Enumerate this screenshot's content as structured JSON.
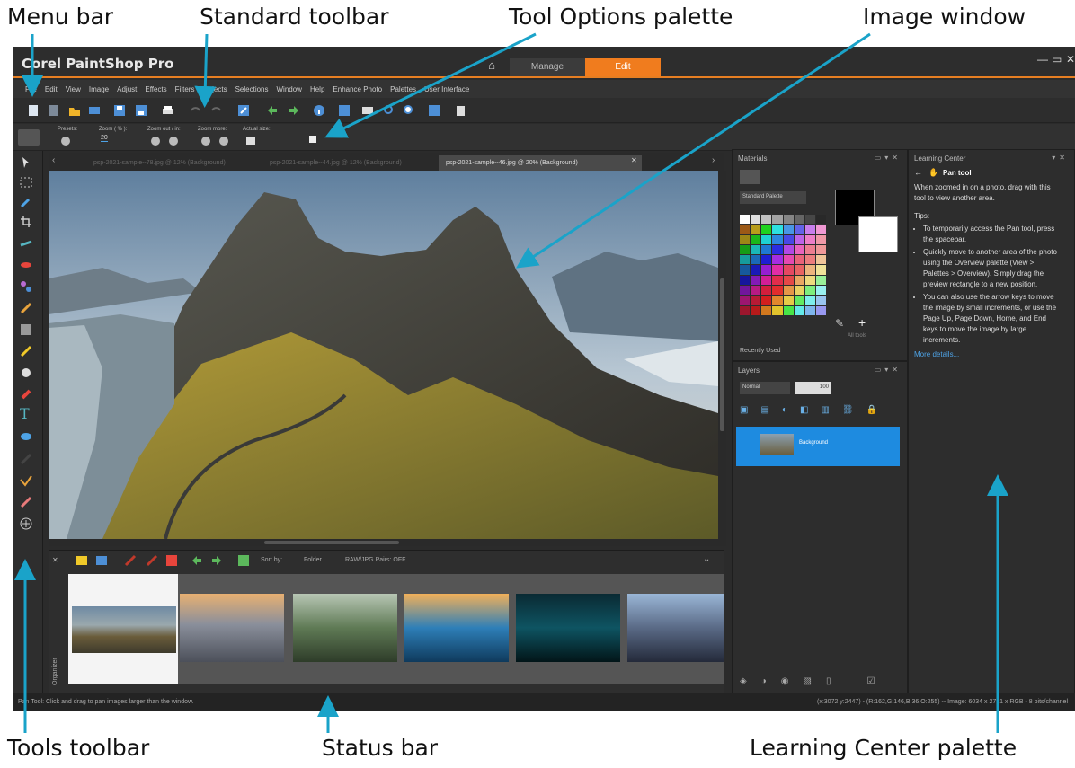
{
  "callouts": {
    "menu_bar": "Menu bar",
    "standard_toolbar": "Standard toolbar",
    "tool_options_palette": "Tool Options palette",
    "image_window": "Image window",
    "tools_toolbar": "Tools toolbar",
    "status_bar": "Status bar",
    "learning_center_palette": "Learning Center palette"
  },
  "app": {
    "title": "Corel PaintShop Pro",
    "home_icon": "home-icon",
    "workspace_tabs": [
      "Manage",
      "Edit"
    ],
    "active_tab": "Edit",
    "accent_color": "#f07c1e",
    "selection_color": "#1e8be0"
  },
  "menu": [
    "File",
    "Edit",
    "View",
    "Image",
    "Adjust",
    "Effects",
    "Filters",
    "Objects",
    "Selections",
    "Window",
    "Help",
    "Enhance Photo",
    "Palettes",
    "User Interface"
  ],
  "tool_options": {
    "presets_label": "Presets:",
    "zoom_label": "Zoom ( % ):",
    "zoom_value": "20",
    "zoom_in_out_label": "Zoom out / in:",
    "zoom_more_label": "Zoom more:",
    "actual_size_label": "Actual size:"
  },
  "document_tabs": [
    {
      "label": "psp-2021-sample--78.jpg @ 12% (Background)",
      "active": false
    },
    {
      "label": "psp-2021-sample--44.jpg @ 12% (Background)",
      "active": false
    },
    {
      "label": "psp-2021-sample--46.jpg @ 20% (Background)",
      "active": true
    }
  ],
  "organizer": {
    "label": "Organizer",
    "sort_label": "Sort by:",
    "sort_value": "Folder",
    "raw_pairs": "RAW/JPG Pairs: OFF"
  },
  "status": {
    "left": "Pan Tool: Click and drag to pan images larger than the window.",
    "right": "(x:3072 y:2447) - (R:162,G:146,B:36,O:255) -- Image: 6034 x 2741 x RGB - 8 bits/channel"
  },
  "materials": {
    "title": "Materials",
    "palette_select": "Standard Palette",
    "all_tools": "All tools",
    "recently_used": "Recently Used"
  },
  "layers": {
    "title": "Layers",
    "blend_mode": "Normal",
    "opacity": "100",
    "layer_name": "Background"
  },
  "learning_center": {
    "title": "Learning Center",
    "tool_name": "Pan tool",
    "intro": "When zoomed in on a photo, drag with this tool to view another area.",
    "tips_label": "Tips:",
    "tips": [
      "To temporarily access the Pan tool, press the spacebar.",
      "Quickly move to another area of the photo using the Overview palette (View > Palettes > Overview). Simply drag the preview rectangle to a new position.",
      "You can also use the arrow keys to move the image by small increments, or use the Page Up, Page Down, Home, and End keys to move the image by large increments."
    ],
    "more_link": "More details..."
  }
}
